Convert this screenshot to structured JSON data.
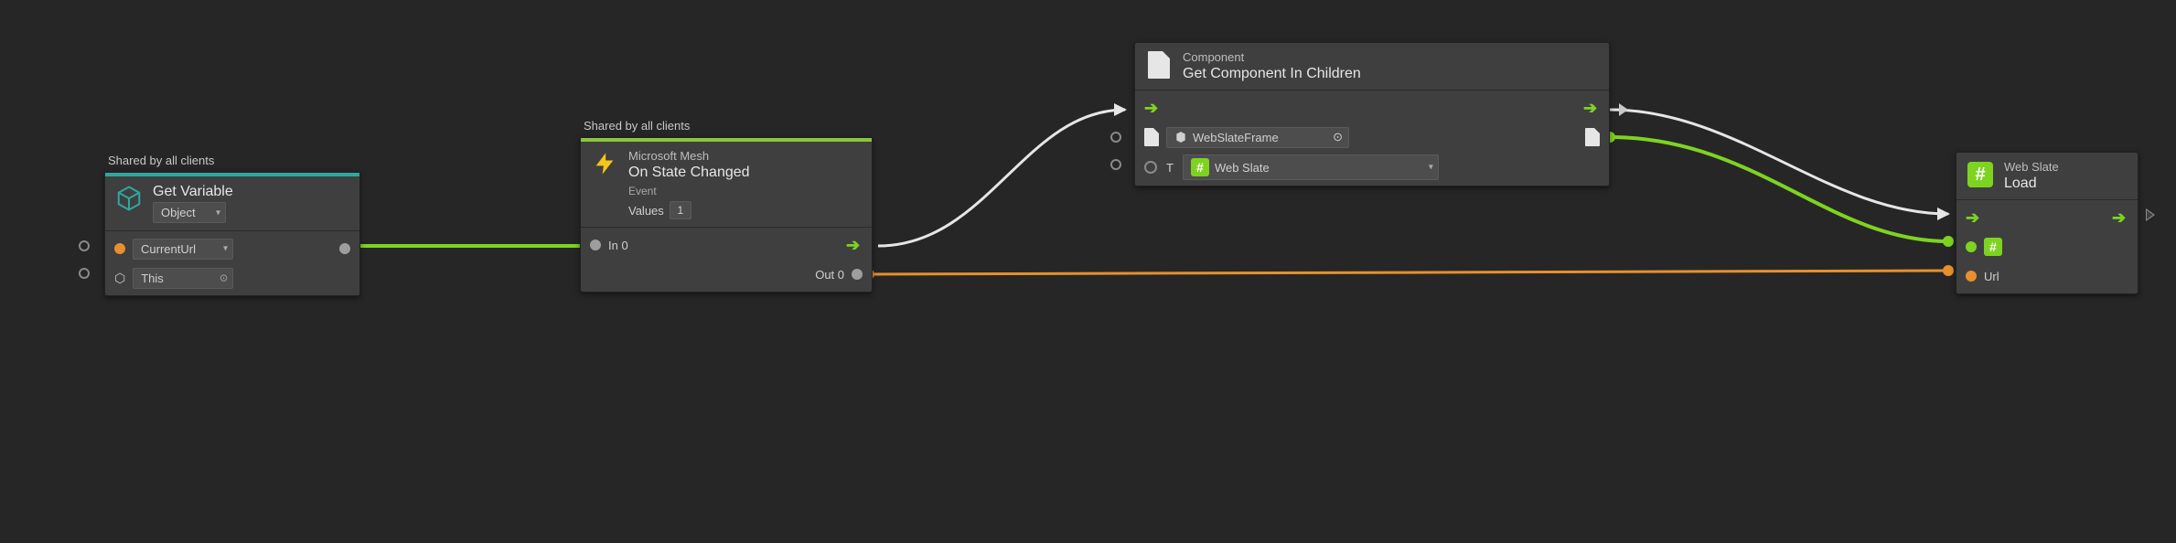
{
  "nodes": {
    "getvar": {
      "subtitle": "Shared by all clients",
      "title": "Get Variable",
      "kind_dropdown": "Object",
      "var_dropdown": "CurrentUrl",
      "target_field": "This"
    },
    "onstate": {
      "subtitle": "Shared by all clients",
      "sup": "Microsoft Mesh",
      "title": "On State Changed",
      "event_label": "Event",
      "values_label": "Values",
      "values_count": "1",
      "in0": "In 0",
      "out0": "Out 0"
    },
    "getcomp": {
      "sup": "Component",
      "title": "Get Component In Children",
      "obj_field": "WebSlateFrame",
      "t_label": "T",
      "type_dropdown": "Web Slate"
    },
    "load": {
      "sup": "Web Slate",
      "title": "Load",
      "url_label": "Url"
    }
  }
}
